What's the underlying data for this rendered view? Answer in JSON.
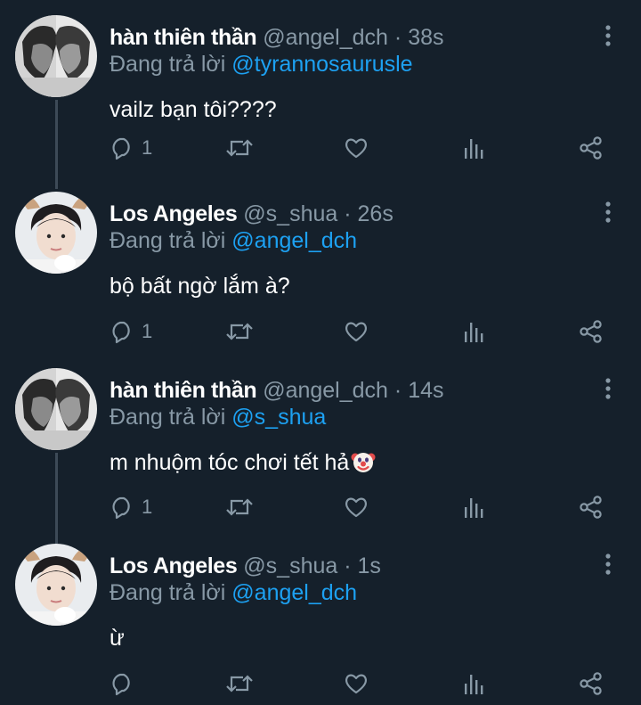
{
  "reply_prefix": "Đang trả lời",
  "tweets": [
    {
      "name": "hàn thiên thần",
      "handle": "@angel_dch",
      "dot": "·",
      "time": "38s",
      "mention": "@tyrannosaurusle",
      "text": "vailz bạn tôi????",
      "reply_count": "1"
    },
    {
      "name": "Los Angeles",
      "handle": "@s_shua",
      "dot": "·",
      "time": "26s",
      "mention": "@angel_dch",
      "text": "bộ bất ngờ lắm à?",
      "reply_count": "1"
    },
    {
      "name": "hàn thiên thần",
      "handle": "@angel_dch",
      "dot": "·",
      "time": "14s",
      "mention": "@s_shua",
      "text": "m nhuộm tóc chơi tết hả",
      "emoji": "clown-face-emoji",
      "reply_count": "1"
    },
    {
      "name": "Los Angeles",
      "handle": "@s_shua",
      "dot": "·",
      "time": "1s",
      "mention": "@angel_dch",
      "text": "ừ",
      "reply_count": ""
    }
  ],
  "icons": {
    "reply": "reply-icon",
    "retweet": "retweet-icon",
    "like": "heart-icon",
    "analytics": "analytics-icon",
    "share": "share-icon",
    "more": "more-vertical-icon"
  },
  "colors": {
    "background": "#15202b",
    "text": "#ffffff",
    "secondary": "#8899a6",
    "link": "#1da1f2",
    "thread_line": "#3d4a57"
  }
}
